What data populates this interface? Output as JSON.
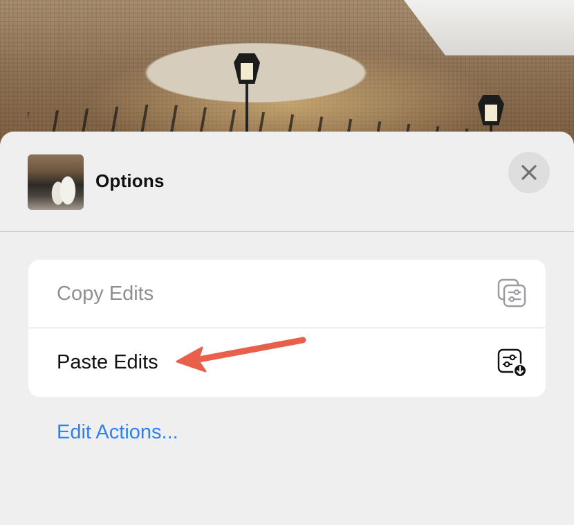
{
  "sheet": {
    "title": "Options",
    "close_icon": "close-icon",
    "thumbnail": "photo-thumbnail"
  },
  "options": [
    {
      "label": "Copy Edits",
      "icon": "copy-edits-icon",
      "enabled": false
    },
    {
      "label": "Paste Edits",
      "icon": "paste-edits-icon",
      "enabled": true
    }
  ],
  "footer_link": "Edit Actions...",
  "annotation": {
    "type": "arrow",
    "color": "#e8604c",
    "points_to": "Paste Edits"
  },
  "colors": {
    "link": "#2f7ff6",
    "disabled_text": "#8e8e93",
    "sheet_bg": "#efefef"
  }
}
